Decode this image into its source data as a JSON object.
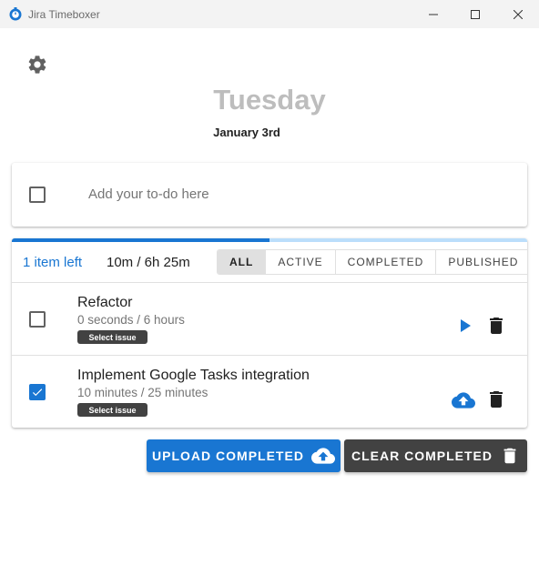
{
  "window": {
    "title": "Jira Timeboxer"
  },
  "header": {
    "day": "Tuesday",
    "date": "January 3rd"
  },
  "new_todo": {
    "placeholder": "Add your to-do here"
  },
  "summary": {
    "items_left": "1 item left",
    "time": "10m / 6h 25m",
    "progress_fraction": 0.5
  },
  "filters": [
    {
      "label": "ALL",
      "active": true
    },
    {
      "label": "ACTIVE",
      "active": false
    },
    {
      "label": "COMPLETED",
      "active": false
    },
    {
      "label": "PUBLISHED",
      "active": false
    }
  ],
  "tasks": [
    {
      "title": "Refactor",
      "time": "0 seconds / 6 hours",
      "chip": "Select issue",
      "checked": false,
      "action_icon": "play-icon"
    },
    {
      "title": "Implement Google Tasks integration",
      "time": "10 minutes / 25 minutes",
      "chip": "Select issue",
      "checked": true,
      "action_icon": "cloud-upload-icon"
    }
  ],
  "actions": {
    "upload_label": "UPLOAD COMPLETED",
    "clear_label": "CLEAR COMPLETED"
  },
  "colors": {
    "accent": "#1976d2",
    "dark": "#424242",
    "muted_title": "#bdbdbd"
  }
}
